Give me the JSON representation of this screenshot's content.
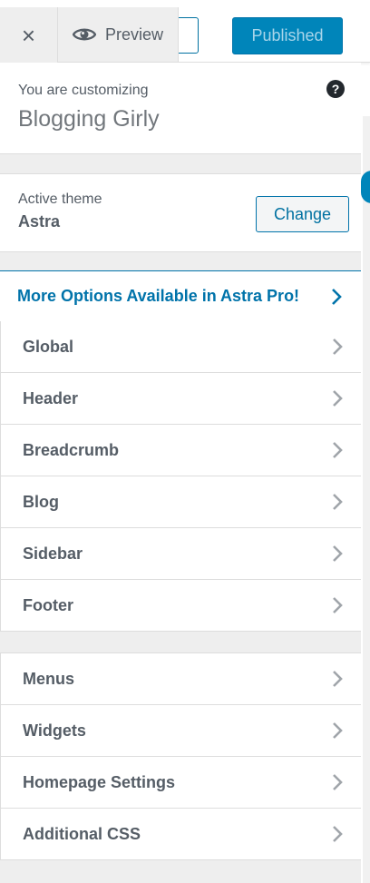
{
  "header": {
    "close_glyph": "×",
    "preview_label": "Preview",
    "publish_label": "Published"
  },
  "info": {
    "customizing_label": "You are customizing",
    "site_name": "Blogging Girly",
    "help_glyph": "?"
  },
  "theme": {
    "label": "Active theme",
    "name": "Astra",
    "change_label": "Change"
  },
  "pro_banner": {
    "label": "More Options Available in Astra Pro!"
  },
  "panels": [
    {
      "label": "Global"
    },
    {
      "label": "Header"
    },
    {
      "label": "Breadcrumb"
    },
    {
      "label": "Blog"
    },
    {
      "label": "Sidebar"
    },
    {
      "label": "Footer"
    }
  ],
  "panels2": [
    {
      "label": "Menus"
    },
    {
      "label": "Widgets"
    },
    {
      "label": "Homepage Settings"
    },
    {
      "label": "Additional CSS"
    }
  ],
  "colors": {
    "accent": "#0073aa",
    "publish_bg": "#0085ba",
    "sidebar_bg": "#eeeeee"
  },
  "icons": [
    "close-icon",
    "eye-icon",
    "help-icon",
    "chevron-right-icon",
    "edit-pencil-icon"
  ]
}
